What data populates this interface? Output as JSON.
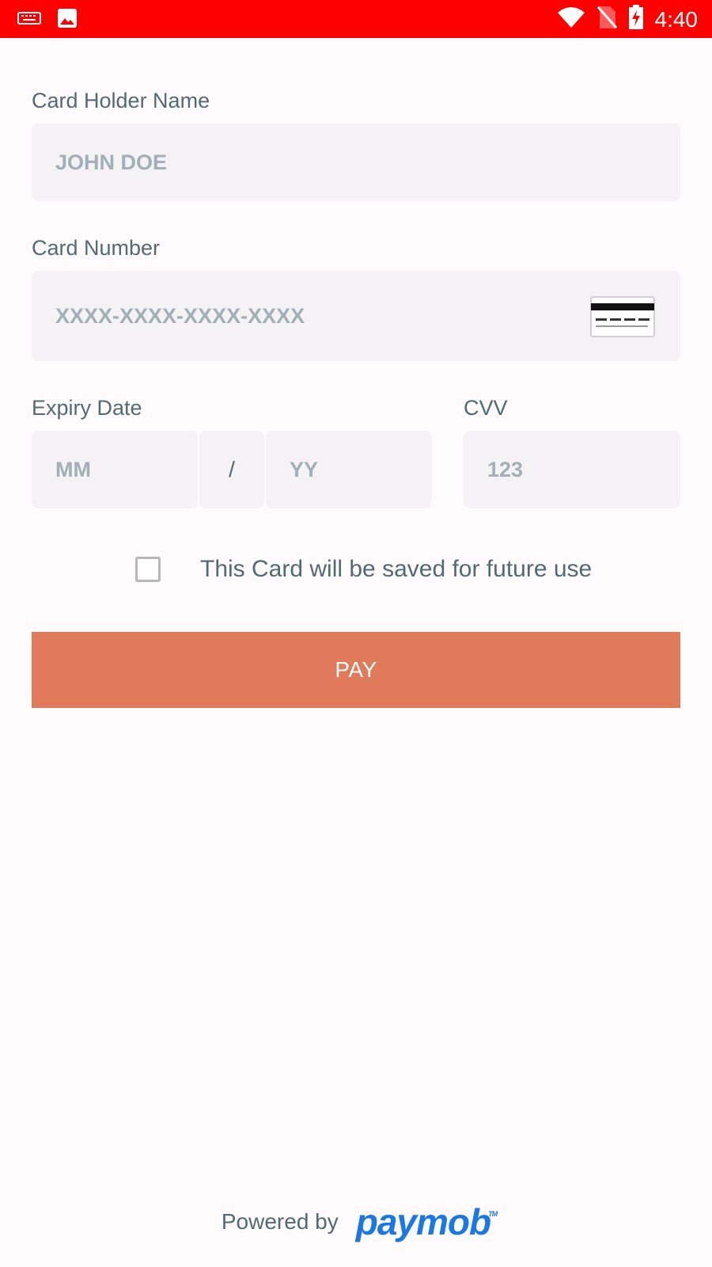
{
  "status_bar": {
    "time": "4:40",
    "left_icons": [
      "keyboard-icon",
      "image-icon"
    ],
    "right_icons": [
      "wifi-icon",
      "no-sim-icon",
      "battery-charging-icon"
    ],
    "color": "#ff0000"
  },
  "form": {
    "card_holder": {
      "label": "Card Holder Name",
      "placeholder": "JOHN DOE",
      "value": ""
    },
    "card_number": {
      "label": "Card Number",
      "placeholder": "XXXX-XXXX-XXXX-XXXX",
      "value": "",
      "icon": "credit-card-icon"
    },
    "expiry": {
      "label": "Expiry Date",
      "month_placeholder": "MM",
      "separator": "/",
      "year_placeholder": "YY"
    },
    "cvv": {
      "label": "CVV",
      "placeholder": "123"
    },
    "save_card": {
      "label": "This Card will be saved for future use",
      "checked": false
    },
    "pay_button": {
      "label": "PAY",
      "color": "#df7a5a"
    }
  },
  "footer": {
    "powered_by": "Powered by",
    "brand": "paymob",
    "trademark": "TM",
    "brand_color": "#1a78e6"
  }
}
